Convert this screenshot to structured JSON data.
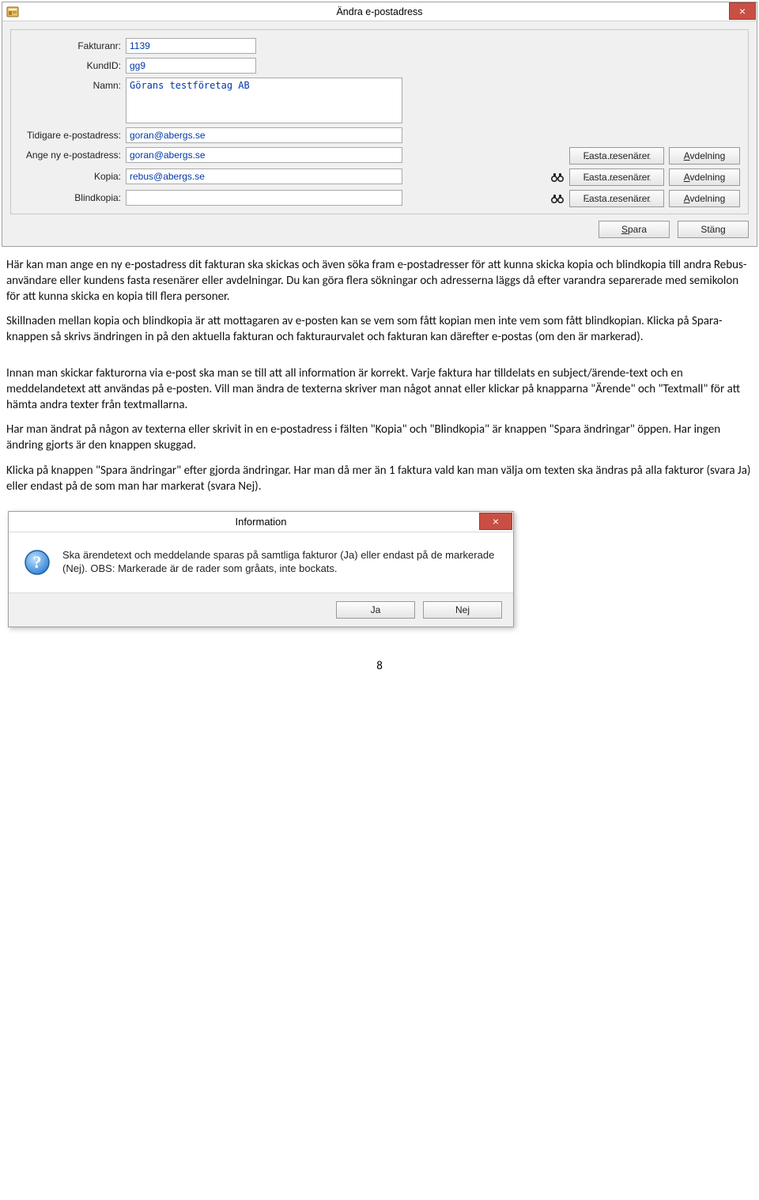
{
  "dialog1": {
    "title": "Ändra e-postadress",
    "close_glyph": "×",
    "labels": {
      "fakturanr": "Fakturanr:",
      "kundid": "KundID:",
      "namn": "Namn:",
      "tidigare": "Tidigare e-postadress:",
      "ny": "Ange ny e-postadress:",
      "kopia": "Kopia:",
      "blindkopia": "Blindkopia:"
    },
    "values": {
      "fakturanr": "1139",
      "kundid": "gg9",
      "namn": "Görans testföretag AB",
      "tidigare": "goran@abergs.se",
      "ny": "goran@abergs.se",
      "kopia": "rebus@abergs.se",
      "blindkopia": ""
    },
    "buttons": {
      "fasta_f": "F",
      "fasta_rest": "asta resenärer",
      "avd_a": "A",
      "avd_rest": "vdelning",
      "spara_s": "S",
      "spara_rest": "para",
      "stang": "Stäng"
    }
  },
  "paragraphs": {
    "p1": "Här kan man ange en ny e-postadress dit fakturan ska skickas och även söka fram e-postadresser för att kunna skicka kopia och blindkopia till andra Rebus-användare eller kundens fasta resenärer eller avdelningar. Du kan göra flera sökningar och adresserna läggs då efter varandra separerade med semikolon för att kunna skicka en kopia till flera personer.",
    "p2": "Skillnaden mellan kopia och blindkopia är att mottagaren av e-posten kan se vem som fått kopian men inte vem som fått blindkopian. Klicka på Spara-knappen så skrivs ändringen in på den aktuella fakturan och fakturaurvalet och fakturan kan därefter e-postas (om den är markerad).",
    "p3": "Innan man skickar fakturorna via e-post ska man se till att all information är korrekt. Varje faktura har tilldelats en subject/ärende-text och en meddelandetext att användas på e-posten. Vill man ändra de texterna skriver man något annat eller klickar på knapparna \"Ärende\" och \"Textmall\" för att hämta andra texter från textmallarna.",
    "p4": "Har man ändrat på någon av texterna eller skrivit in en e-postadress i fälten \"Kopia\" och \"Blindkopia\" är knappen \"Spara ändringar\" öppen. Har ingen ändring gjorts är den knappen skuggad.",
    "p5": "Klicka på knappen \"Spara ändringar\" efter gjorda ändringar. Har man då mer än 1 faktura vald kan man välja om texten ska ändras på alla fakturor (svara Ja) eller endast på de som man har markerat (svara Nej)."
  },
  "dialog2": {
    "title": "Information",
    "close_glyph": "×",
    "message": "Ska ärendetext och meddelande sparas på samtliga fakturor (Ja) eller endast på de markerade (Nej). OBS: Markerade är de rader som gråats, inte bockats.",
    "ja": "Ja",
    "nej": "Nej"
  },
  "page_number": "8"
}
